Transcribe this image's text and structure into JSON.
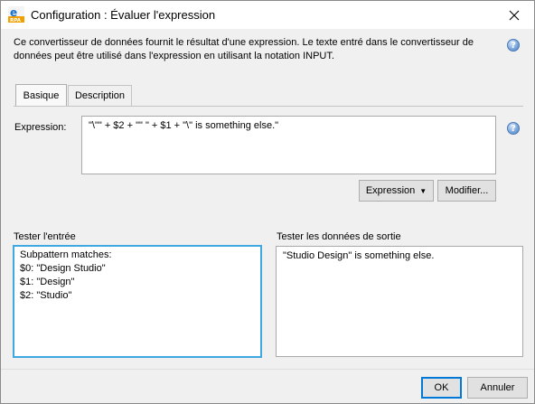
{
  "window": {
    "title": "Configuration : Évaluer l'expression"
  },
  "description": "Ce convertisseur de données fournit le résultat d'une expression. Le texte entré dans le convertisseur de données peut être utilisé dans l'expression en utilisant la notation INPUT.",
  "tabs": [
    {
      "label": "Basique",
      "active": true
    },
    {
      "label": "Description",
      "active": false
    }
  ],
  "expression": {
    "label": "Expression:",
    "value": "\"\\\"\" + $2 + \"\" \" + $1 + \"\\\" is something else.\""
  },
  "buttons": {
    "expression": "Expression",
    "modify": "Modifier...",
    "ok": "OK",
    "cancel": "Annuler"
  },
  "test_input": {
    "label": "Tester l'entrée",
    "lines": [
      "Subpattern matches:",
      "$0: \"Design Studio\"",
      "$1: \"Design\"",
      "$2: \"Studio\""
    ]
  },
  "test_output": {
    "label": "Tester les données de sortie",
    "value": "\"Studio Design\" is something else."
  },
  "icons": {
    "app": "app-icon",
    "close": "close-icon",
    "help": "help-icon",
    "dropdown": "chevron-down-icon"
  },
  "colors": {
    "focus_border": "#3fa7e2",
    "primary_border": "#0078d7",
    "help_blue": "#4f7fc0"
  }
}
